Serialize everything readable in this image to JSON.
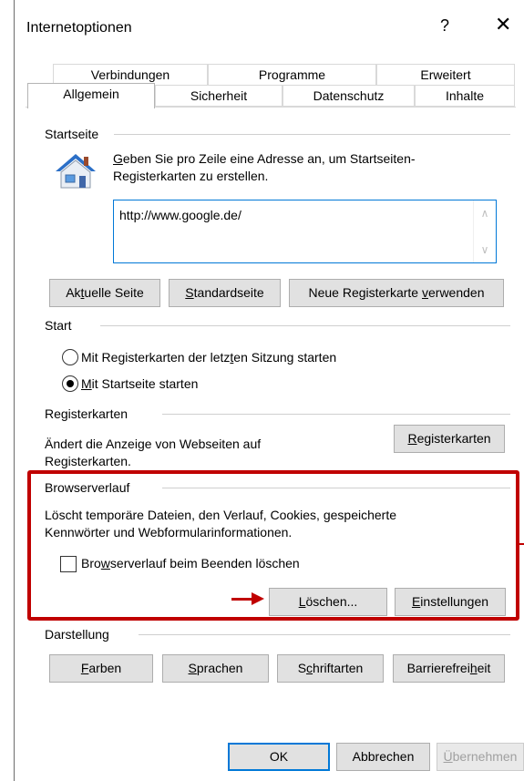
{
  "window": {
    "title": "Internetoptionen",
    "help_glyph": "?",
    "close_glyph": "✕"
  },
  "tabs": {
    "row1": [
      {
        "label": "Verbindungen"
      },
      {
        "label": "Programme"
      },
      {
        "label": "Erweitert"
      }
    ],
    "row2": [
      {
        "label": "Allgemein",
        "selected": true
      },
      {
        "label": "Sicherheit"
      },
      {
        "label": "Datenschutz"
      },
      {
        "label": "Inhalte"
      }
    ]
  },
  "startseite": {
    "group_label": "Startseite",
    "description": "Geben Sie pro Zeile eine Adresse an, um Startseiten-Registerkarten zu erstellen.",
    "description_line1_first": "G",
    "description_line1_rest": "eben Sie pro Zeile eine Adresse an, um Startseiten-",
    "description_line2": "Registerkarten zu erstellen.",
    "url_value": "http://www.google.de/",
    "buttons": {
      "aktuelle_a": "Ak",
      "aktuelle_u": "t",
      "aktuelle_b": "uelle Seite",
      "standard_a": "",
      "standard_u": "S",
      "standard_b": "tandardseite",
      "neue_a": "Neue Registerkarte ",
      "neue_u": "v",
      "neue_b": "erwenden"
    }
  },
  "start": {
    "group_label": "Start",
    "option1_a": "Mit Registerkarten der letz",
    "option1_u": "t",
    "option1_b": "en Sitzung starten",
    "option2_a": "",
    "option2_u": "M",
    "option2_b": "it Startseite starten",
    "selected": "option2"
  },
  "registerkarten": {
    "group_label": "Registerkarten",
    "description_line1": "Ändert die Anzeige von Webseiten auf",
    "description_line2": "Registerkarten.",
    "button_u": "R",
    "button_b": "egisterkarten"
  },
  "browserverlauf": {
    "group_label": "Browserverlauf",
    "description_line1": "Löscht temporäre Dateien, den Verlauf, Cookies, gespeicherte",
    "description_line2": "Kennwörter und Webformularinformationen.",
    "checkbox_a": "Bro",
    "checkbox_u": "w",
    "checkbox_b": "serverlauf beim Beenden löschen",
    "checkbox_checked": false,
    "delete_u": "L",
    "delete_b": "öschen...",
    "settings_u": "E",
    "settings_b": "instellungen"
  },
  "darstellung": {
    "group_label": "Darstellung",
    "farben_u": "F",
    "farben_b": "arben",
    "sprachen_u": "S",
    "sprachen_b": "prachen",
    "schrift_a": "S",
    "schrift_u": "c",
    "schrift_b": "hriftarten",
    "barriere_a": "Barrierefrei",
    "barriere_u": "h",
    "barriere_b": "eit"
  },
  "footer": {
    "ok": "OK",
    "cancel": "Abbrechen",
    "apply_u": "Ü",
    "apply_b": "bernehmen"
  },
  "annotation": {
    "highlight_color": "#c00000"
  }
}
